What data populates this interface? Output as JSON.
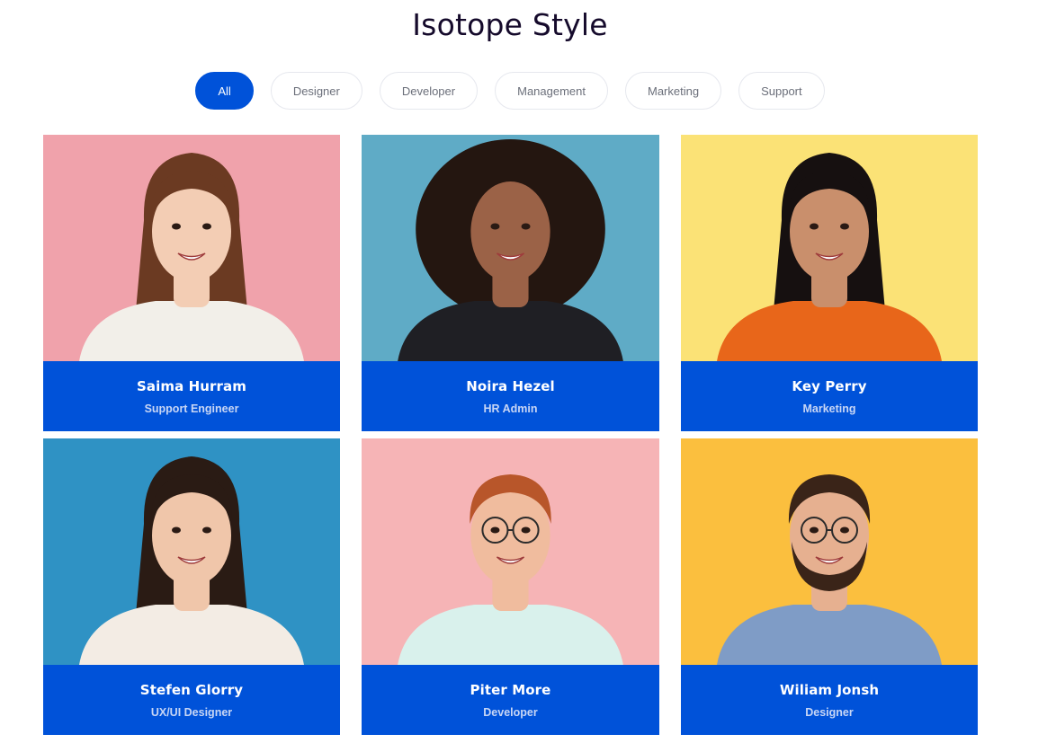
{
  "header": {
    "title": "Isotope Style"
  },
  "filters": [
    {
      "label": "All",
      "active": true
    },
    {
      "label": "Designer",
      "active": false
    },
    {
      "label": "Developer",
      "active": false
    },
    {
      "label": "Management",
      "active": false
    },
    {
      "label": "Marketing",
      "active": false
    },
    {
      "label": "Support",
      "active": false
    }
  ],
  "members": [
    {
      "name": "Saima Hurram",
      "role": "Support Engineer",
      "bg": "#f0a2ab",
      "skin": "#f3cdb4",
      "hair": "#6b3a22",
      "shirt": "#f2efe9"
    },
    {
      "name": "Noira Hezel",
      "role": "HR Admin",
      "bg": "#5fabc6",
      "skin": "#9b6247",
      "hair": "#241610",
      "shirt": "#1f1f24"
    },
    {
      "name": "Key Perry",
      "role": "Marketing",
      "bg": "#fbe276",
      "skin": "#c98f6c",
      "hair": "#161010",
      "shirt": "#e8661a"
    },
    {
      "name": "Stefen Glorry",
      "role": "UX/UI Designer",
      "bg": "#2f92c4",
      "skin": "#f0c6aa",
      "hair": "#2a1b14",
      "shirt": "#f3ece4"
    },
    {
      "name": "Piter More",
      "role": "Developer",
      "bg": "#f6b4b6",
      "skin": "#f0bc9e",
      "hair": "#b8562a",
      "shirt": "#d9f1ec"
    },
    {
      "name": "Wiliam Jonsh",
      "role": "Designer",
      "bg": "#fbbf3e",
      "skin": "#e6b090",
      "hair": "#3a2418",
      "shirt": "#7f9cc6"
    }
  ],
  "accent": "#0052d9"
}
